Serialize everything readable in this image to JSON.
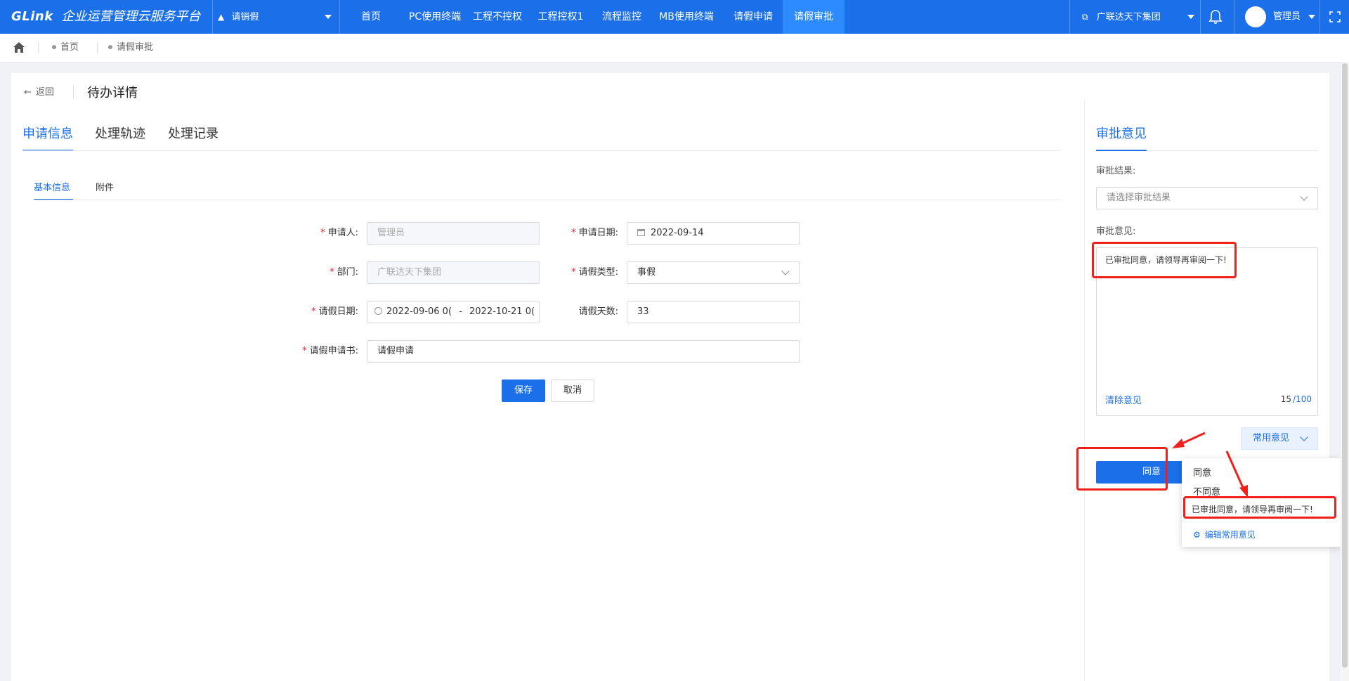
{
  "topbar": {
    "logo_brand": "GLink",
    "logo_text": "企业运营管理云服务平台",
    "app_selector": "请销假",
    "nav": [
      "首页",
      "PC使用终端",
      "工程不控权",
      "工程控权1",
      "流程监控",
      "MB使用终端",
      "请假申请",
      "请假审批"
    ],
    "active_nav_index": 7,
    "org_selector": "广联达天下集团",
    "username": "管理员"
  },
  "breadcrumb": [
    "首页",
    "请假审批"
  ],
  "page": {
    "back_label": "返回",
    "title": "待办详情",
    "tabs": [
      "申请信息",
      "处理轨迹",
      "处理记录"
    ],
    "active_tab_index": 0,
    "subtabs": [
      "基本信息",
      "附件"
    ],
    "active_subtab_index": 0
  },
  "form": {
    "applicant_label": "申请人:",
    "applicant_value": "管理员",
    "apply_date_label": "申请日期:",
    "apply_date_value": "2022-09-14",
    "department_label": "部门:",
    "department_value": "广联达天下集团",
    "leave_type_label": "请假类型:",
    "leave_type_value": "事假",
    "leave_date_label": "请假日期:",
    "leave_date_start": "2022-09-06 0(",
    "leave_date_sep": "-",
    "leave_date_end": "2022-10-21 0(",
    "leave_days_label": "请假天数:",
    "leave_days_value": "33",
    "letter_label": "请假申请书:",
    "letter_value": "请假申请",
    "save_label": "保存",
    "cancel_label": "取消"
  },
  "approval": {
    "title": "审批意见",
    "result_label": "审批结果:",
    "result_placeholder": "请选择审批结果",
    "opinion_label": "审批意见:",
    "opinion_value": "已审批同意，请领导再审阅一下!",
    "clear_label": "清除意见",
    "count_current": "15",
    "count_max": "/100",
    "common_opinion_label": "常用意见",
    "agree_button": "同意",
    "dropdown": {
      "items": [
        "同意",
        "不同意",
        "已审批同意，请领导再审阅一下!"
      ],
      "edit_label": "编辑常用意见"
    }
  },
  "colors": {
    "primary": "#1b6fe8",
    "nav_active": "#2e8bff",
    "annotation_red": "#f0211b"
  }
}
